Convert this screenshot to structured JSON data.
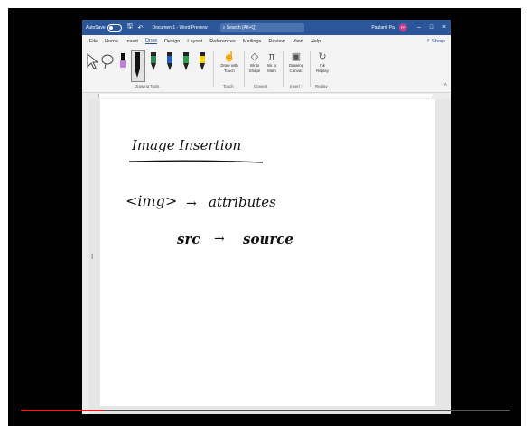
{
  "titlebar": {
    "autosave": "AutoSave",
    "autosave_state": "Off",
    "document_title": "Document1 - Word Preview",
    "search_placeholder": "Search (Alt+Q)",
    "user_name": "Paulami Pal",
    "avatar_initials": "PP"
  },
  "tabs": [
    "File",
    "Home",
    "Insert",
    "Draw",
    "Design",
    "Layout",
    "References",
    "Mailings",
    "Review",
    "View",
    "Help"
  ],
  "active_tab": "Draw",
  "share_label": "Share",
  "ribbon": {
    "pen_colors": [
      "#111111",
      "#2e8b57",
      "#2060c0",
      "#2aa04a",
      "#f0d000"
    ],
    "highlighter_color": "#c080e0",
    "groups": {
      "drawing_tools": "Drawing Tools",
      "touch": "Touch",
      "convert": "Convert",
      "insert": "Insert",
      "replay": "Replay"
    },
    "buttons": {
      "draw_with_touch": "Draw with Touch",
      "ink_to_shape": "Ink to Shape",
      "ink_to_math": "Ink to Math",
      "drawing_canvas": "Drawing Canvas",
      "ink_replay": "Ink Replay"
    }
  },
  "document": {
    "heading": "Image Insertion",
    "line1_tag": "<img>",
    "line1_arrow": "→",
    "line1_value": "attributes",
    "line2_tag": "src",
    "line2_arrow": "→",
    "line2_value": "source"
  },
  "video_progress_percent": 17
}
